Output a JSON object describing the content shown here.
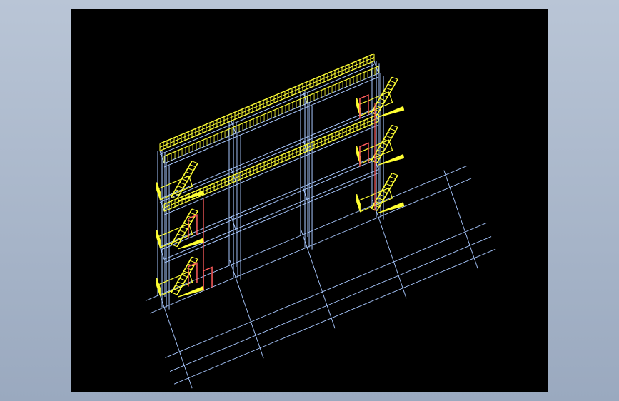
{
  "viewport": {
    "name": "cad-model-viewport",
    "background": "#000000"
  },
  "colors": {
    "grid": "#a8c8ff",
    "columns": "#a8c8ff",
    "railings": "#ffff33",
    "stairs": "#ffff33",
    "doors": "#ff5c5c"
  },
  "model": {
    "type": "isometric-wireframe",
    "subject": "multi-storey-steel-frame-with-stairs",
    "floors": 3,
    "bays": 3,
    "stair_towers": 2
  }
}
